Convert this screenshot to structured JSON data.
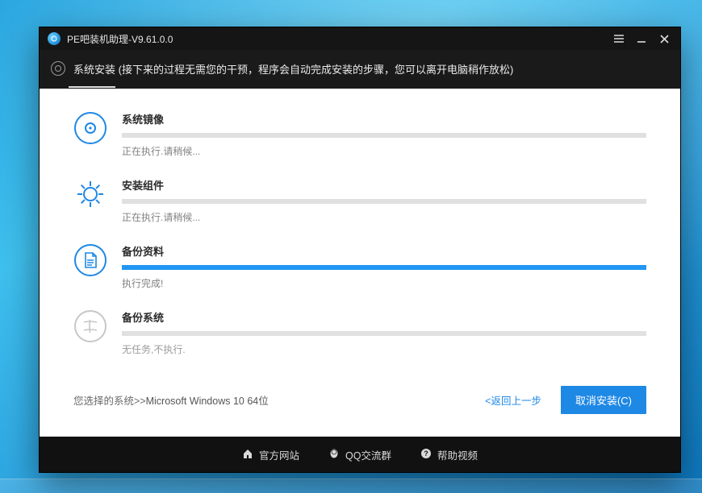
{
  "window": {
    "title": "PE吧装机助理-V9.61.0.0"
  },
  "header": {
    "title_main": "系统安装",
    "title_sub": " (接下来的过程无需您的干预，程序会自动完成安装的步骤，您可以离开电脑稍作放松)"
  },
  "steps": [
    {
      "id": "image",
      "title": "系统镜像",
      "status": "正在执行.请稍候...",
      "progress": 0,
      "active": true,
      "color": "blue"
    },
    {
      "id": "components",
      "title": "安装组件",
      "status": "正在执行.请稍候...",
      "progress": 0,
      "active": true,
      "color": "blue"
    },
    {
      "id": "backup-data",
      "title": "备份资料",
      "status": "执行完成!",
      "progress": 100,
      "active": true,
      "color": "blue"
    },
    {
      "id": "backup-system",
      "title": "备份系统",
      "status": "无任务,不执行.",
      "progress": 0,
      "active": false,
      "color": "gray"
    }
  ],
  "footer": {
    "selected_label": "您选择的系统>>",
    "selected_value": "Microsoft Windows 10 64位",
    "back_label": "<返回上一步",
    "cancel_label": "取消安装(C)"
  },
  "bottom": {
    "site": "官方网站",
    "qq": "QQ交流群",
    "help": "帮助视频"
  }
}
